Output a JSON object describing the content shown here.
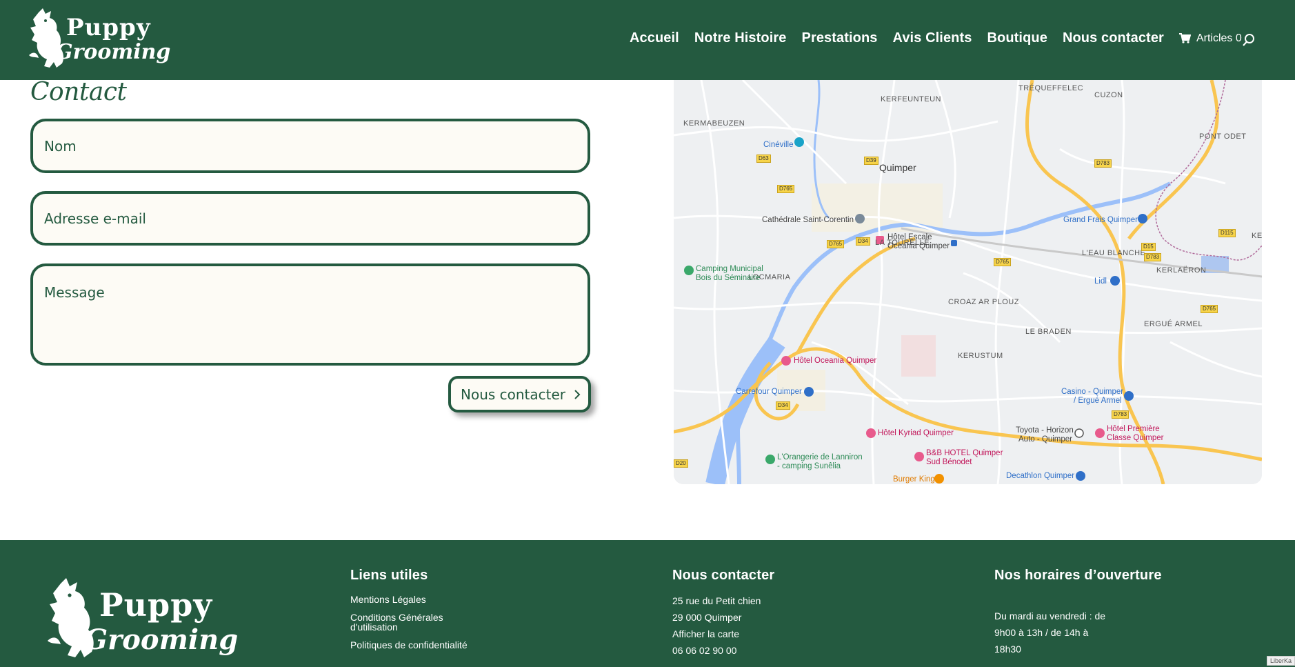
{
  "brand": {
    "line1": "Puppy",
    "line2": "Grooming"
  },
  "nav": {
    "items": [
      "Accueil",
      "Notre Histoire",
      "Prestations",
      "Avis Clients",
      "Boutique",
      "Nous contacter"
    ],
    "cart_label": "Articles 0"
  },
  "contact": {
    "title": "Contact",
    "name_placeholder": "Nom",
    "email_placeholder": "Adresse e-mail",
    "message_placeholder": "Message",
    "submit_label": "Nous contacter"
  },
  "map": {
    "areas": [
      "KERFEUNTEUN",
      "TRÉQUEFFELEC",
      "CUZON",
      "KERMABEUZEN",
      "PONT ODET",
      "Quimper",
      "LA TOURELLE",
      "L'EAU BLANCHE",
      "KERLAËRON",
      "LOCMARIA",
      "CROAZ AR PLOUZ",
      "LE BRADEN",
      "ERGUÉ ARMEL",
      "KERUSTUM",
      "KE"
    ],
    "pois": {
      "cineville": "Cinéville",
      "cathedrale": "Cathédrale Saint-Corentin",
      "hotel_escale": "Hôtel Escale",
      "hotel_escale_2": "Oceania Quimper",
      "grand_frais": "Grand Frais Quimper",
      "camping_1": "Camping Municipal",
      "camping_2": "Bois du Séminaire",
      "lidl": "Lidl",
      "hotel_oceania": "Hôtel Oceania Quimper",
      "carrefour": "Carrefour Quimper",
      "casino_1": "Casino - Quimper",
      "casino_2": "/ Ergué Armel",
      "hotel_kyriad": "Hôtel Kyriad Quimper",
      "toyota_1": "Toyota - Horizon",
      "toyota_2": "Auto - Quimper",
      "hotel_premiere_1": "Hôtel Première",
      "hotel_premiere_2": "Classe Quimper",
      "orangerie_1": "L'Orangerie de Lanniron",
      "orangerie_2": "- camping Sunêlia",
      "bb_hotel_1": "B&B HOTEL Quimper",
      "bb_hotel_2": "Sud Bénodet",
      "burger_king": "Burger King",
      "decathlon": "Decathlon Quimper"
    },
    "roads": [
      "D63",
      "D39",
      "D765",
      "D783",
      "D765",
      "D34",
      "D765",
      "D15",
      "D115",
      "D783",
      "D765",
      "D34",
      "D783",
      "D20"
    ],
    "colors": {
      "water": "#9cc0f9",
      "major_road": "#f9c550",
      "minor_road": "#ffffff",
      "land": "#eef0f2"
    }
  },
  "footer": {
    "links_title": "Liens utiles",
    "links": [
      "Mentions Légales",
      "Conditions Générales d'utilisation",
      "Politiques de confidentialité"
    ],
    "contact_title": "Nous contacter",
    "contact_lines": [
      "25 rue du Petit chien",
      "29 000 Quimper",
      "Afficher la carte",
      "06 06 02 90 00"
    ],
    "hours_title": "Nos horaires d’ouverture",
    "hours_lines": [
      "Du mardi au vendredi : de",
      "9h00 à 13h / de 14h à",
      "18h30"
    ],
    "badge": "LiberKa"
  },
  "colors": {
    "brand_green": "#245a40",
    "field_bg": "#fdfbf5",
    "white": "#ffffff"
  }
}
